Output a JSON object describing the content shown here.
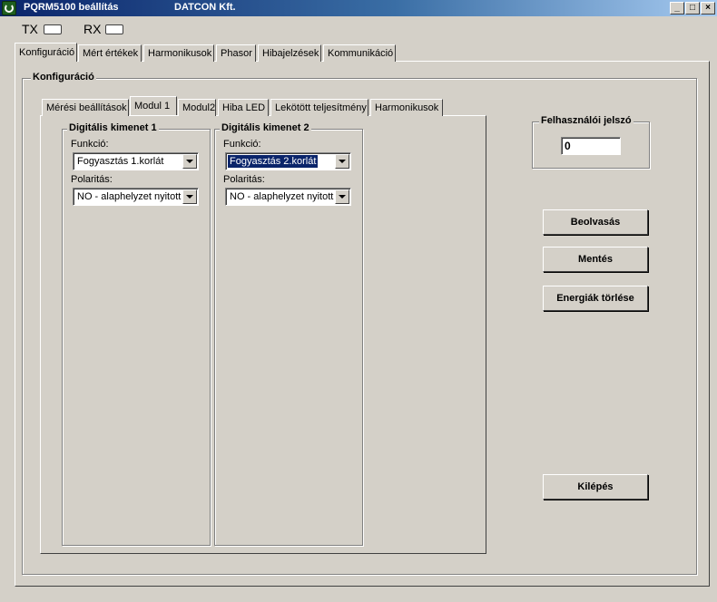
{
  "window": {
    "title": "PQRM5100 beállítás",
    "company": "DATCON Kft.",
    "controls": {
      "minimize": "_",
      "maximize": "□",
      "close": "×"
    }
  },
  "indicators": {
    "tx": "TX",
    "rx": "RX"
  },
  "main_tabs": [
    "Konfiguráció",
    "Mért értékek",
    "Harmonikusok",
    "Phasor",
    "Hibajelzések",
    "Kommunikáció"
  ],
  "main_tab_active": "Konfiguráció",
  "config_group": {
    "title": "Konfiguráció"
  },
  "sub_tabs": [
    "Mérési beállítások",
    "Modul 1",
    "Modul2",
    "Hiba LED",
    "Lekötött teljesítmény",
    "Harmonikusok"
  ],
  "sub_tab_active": "Modul 1",
  "output1": {
    "title": "Digitális kimenet 1",
    "function_label": "Funkció:",
    "function_value": "Fogyasztás 1.korlát",
    "polarity_label": "Polaritás:",
    "polarity_value": "NO - alaphelyzet nyitott"
  },
  "output2": {
    "title": "Digitális kimenet 2",
    "function_label": "Funkció:",
    "function_value": "Fogyasztás 2.korlát",
    "polarity_label": "Polaritás:",
    "polarity_value": "NO - alaphelyzet nyitott"
  },
  "password": {
    "title": "Felhasználói jelszó",
    "value": "0"
  },
  "buttons": {
    "read": "Beolvasás",
    "save": "Mentés",
    "clear_energy": "Energiák törlése",
    "exit": "Kilépés"
  }
}
